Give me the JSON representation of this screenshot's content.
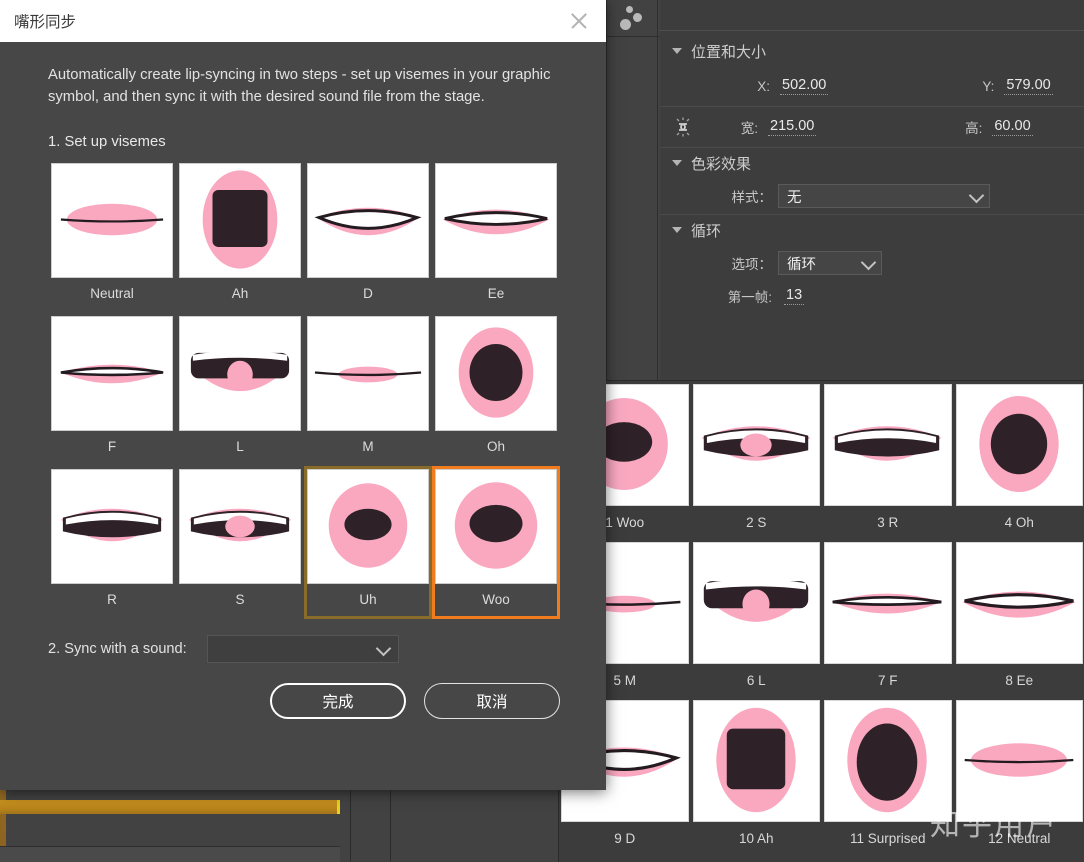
{
  "dialog": {
    "title": "嘴形同步",
    "close_icon": "close-icon",
    "description": "Automatically create lip-syncing in two steps - set up visemes in your graphic symbol, and then sync it with the desired sound file from the stage.",
    "step1_label": "1. Set up visemes",
    "step2_label": "2. Sync with a sound:",
    "sound_select_value": "",
    "sound_select_placeholder": "",
    "done_button": "完成",
    "cancel_button": "取消",
    "visemes": [
      {
        "label": "Neutral",
        "shape": "neutral",
        "state": "normal"
      },
      {
        "label": "Ah",
        "shape": "ah",
        "state": "normal"
      },
      {
        "label": "D",
        "shape": "d",
        "state": "normal"
      },
      {
        "label": "Ee",
        "shape": "ee",
        "state": "normal"
      },
      {
        "label": "F",
        "shape": "f",
        "state": "normal"
      },
      {
        "label": "L",
        "shape": "l",
        "state": "normal"
      },
      {
        "label": "M",
        "shape": "m",
        "state": "normal"
      },
      {
        "label": "Oh",
        "shape": "oh",
        "state": "normal"
      },
      {
        "label": "R",
        "shape": "r",
        "state": "normal"
      },
      {
        "label": "S",
        "shape": "s",
        "state": "normal"
      },
      {
        "label": "Uh",
        "shape": "uh",
        "state": "highlight"
      },
      {
        "label": "Woo",
        "shape": "woo",
        "state": "selected"
      }
    ]
  },
  "properties": {
    "position_section": {
      "title": "位置和大小",
      "x_label": "X:",
      "x_value": "502.00",
      "y_label": "Y:",
      "y_value": "579.00",
      "width_label": "宽:",
      "width_value": "215.00",
      "height_label": "高:",
      "height_value": "60.00",
      "link_icon": "constrain-proportions-icon"
    },
    "color_section": {
      "title": "色彩效果",
      "style_label": "样式：",
      "style_value": "无"
    },
    "loop_section": {
      "title": "循环",
      "option_label": "选项：",
      "option_value": "循环",
      "first_frame_label": "第一帧:",
      "first_frame_value": "13"
    }
  },
  "preview_panel": {
    "frames": [
      {
        "label": "1 Woo",
        "shape": "woo"
      },
      {
        "label": "2 S",
        "shape": "s"
      },
      {
        "label": "3 R",
        "shape": "r"
      },
      {
        "label": "4 Oh",
        "shape": "oh"
      },
      {
        "label": "5 M",
        "shape": "m"
      },
      {
        "label": "6 L",
        "shape": "l"
      },
      {
        "label": "7 F",
        "shape": "f"
      },
      {
        "label": "8 Ee",
        "shape": "ee"
      },
      {
        "label": "9 D",
        "shape": "d"
      },
      {
        "label": "10 Ah",
        "shape": "ah"
      },
      {
        "label": "11 Surprised",
        "shape": "surprised"
      },
      {
        "label": "12 Neutral",
        "shape": "neutral"
      }
    ]
  },
  "watermark": "知乎用户",
  "colors": {
    "accent_selected": "#f07c1e",
    "highlight_border": "#8a6c2a",
    "panel_bg": "#3d3d3d",
    "dialog_bg": "#474747",
    "title_bar": "#ffffff",
    "lip_pink": "#f9a8c0",
    "mouth_dark": "#2e2228",
    "timeline_gold": "#c9921f"
  }
}
